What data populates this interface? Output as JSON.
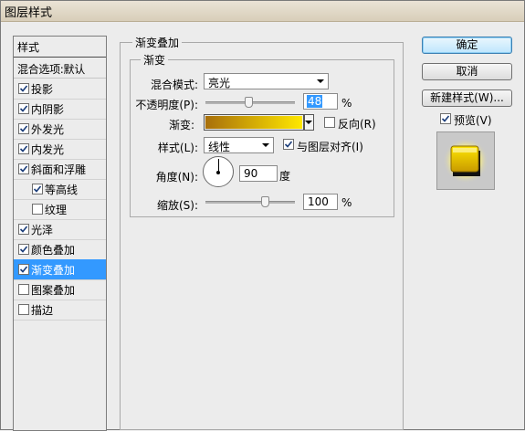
{
  "window": {
    "title": "图层样式"
  },
  "styles_panel": {
    "header": "样式",
    "blend_options": "混合选项:默认",
    "items": [
      {
        "label": "投影",
        "checked": true,
        "sub": false,
        "selected": false
      },
      {
        "label": "内阴影",
        "checked": true,
        "sub": false,
        "selected": false
      },
      {
        "label": "外发光",
        "checked": true,
        "sub": false,
        "selected": false
      },
      {
        "label": "内发光",
        "checked": true,
        "sub": false,
        "selected": false
      },
      {
        "label": "斜面和浮雕",
        "checked": true,
        "sub": false,
        "selected": false
      },
      {
        "label": "等高线",
        "checked": true,
        "sub": true,
        "selected": false
      },
      {
        "label": "纹理",
        "checked": false,
        "sub": true,
        "selected": false
      },
      {
        "label": "光泽",
        "checked": true,
        "sub": false,
        "selected": false
      },
      {
        "label": "颜色叠加",
        "checked": true,
        "sub": false,
        "selected": false
      },
      {
        "label": "渐变叠加",
        "checked": true,
        "sub": false,
        "selected": true
      },
      {
        "label": "图案叠加",
        "checked": false,
        "sub": false,
        "selected": false
      },
      {
        "label": "描边",
        "checked": false,
        "sub": false,
        "selected": false
      }
    ]
  },
  "gradient_overlay": {
    "group_title": "渐变叠加",
    "subgroup_title": "渐变",
    "blend_mode_label": "混合模式:",
    "blend_mode_value": "亮光",
    "opacity_label": "不透明度(P):",
    "opacity_value": "48",
    "opacity_unit": "%",
    "opacity_fraction": 0.48,
    "gradient_label": "渐变:",
    "reverse_label": "反向(R)",
    "reverse_checked": false,
    "style_label": "样式(L):",
    "style_value": "线性",
    "align_label": "与图层对齐(I)",
    "align_checked": true,
    "angle_label": "角度(N):",
    "angle_value": "90",
    "angle_unit": "度",
    "scale_label": "缩放(S):",
    "scale_value": "100",
    "scale_unit": "%",
    "scale_fraction": 0.66
  },
  "buttons": {
    "ok": "确定",
    "cancel": "取消",
    "new_style": "新建样式(W)...",
    "preview": "预览(V)",
    "preview_checked": true
  },
  "colors": {
    "selection": "#3399ff",
    "gradient_start": "#a86f0b",
    "gradient_end": "#ffe800"
  }
}
